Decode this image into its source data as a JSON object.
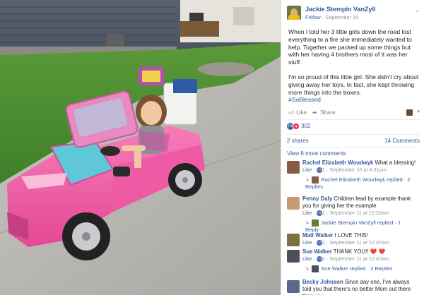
{
  "header": {
    "author_name": "Jackie Stempin VanZyll",
    "follow_label": "Follow",
    "separator": " · ",
    "date": "September 10",
    "menu_icon": "chevron-down-icon"
  },
  "post": {
    "paragraph1": "When I told her 3 little girls down the road lost everything to a fire she immediately wanted to help. Together we packed up some things but with her having 4 brothers most of it was her stuff.",
    "paragraph2": "I'm so proud of this little girl. She didn't cry about giving away her toys. In fact, she kept throwing more things into the boxes.",
    "hashtag": "#SoBlessed"
  },
  "actions": {
    "like_label": "Like",
    "share_label": "Share"
  },
  "reactions": {
    "count": "302",
    "shares": "2 shares",
    "comments": "14 Comments"
  },
  "comments": {
    "view_more": "View 8 more comments",
    "items": [
      {
        "name": "Rachel Elizabeth Woudwyk",
        "text": "What a blessing!",
        "like": "Like",
        "likes": "1",
        "time": "September 10 at 4:31pm",
        "reply": {
          "name": "Rachel Elizabeth Woudwyk",
          "verb": "replied",
          "count_label": "2 Replies"
        }
      },
      {
        "name": "Penny Daly",
        "text": "Children lead by example thank you for giving her the example",
        "like": "Like",
        "likes": "1",
        "time": "September 11 at 12:20am",
        "reply": {
          "name": "Jackie Stempin VanZyll",
          "verb": "replied",
          "count_label": "1 Reply"
        }
      },
      {
        "name": "Matt Walker",
        "text": "I LOVE THIS!",
        "like": "Like",
        "likes": "1",
        "time": "September 11 at 12:37am"
      },
      {
        "name": "Sue Walker",
        "text": "THANK YOU!! ❤️ ❤️",
        "like": "Like",
        "likes": "2",
        "time": "September 11 at 12:40am",
        "reply": {
          "name": "Sue Walker",
          "verb": "replied",
          "count_label": "2 Replies"
        }
      },
      {
        "name": "Becky Johnson",
        "text": "Since day one, I've always told you that there's no better Mom out there than you."
      }
    ]
  },
  "colors": {
    "link": "#365899",
    "meta": "#90949c",
    "like_blue": "#4267b2",
    "love_red": "#f0284a",
    "car_pink": "#f35fa6"
  }
}
